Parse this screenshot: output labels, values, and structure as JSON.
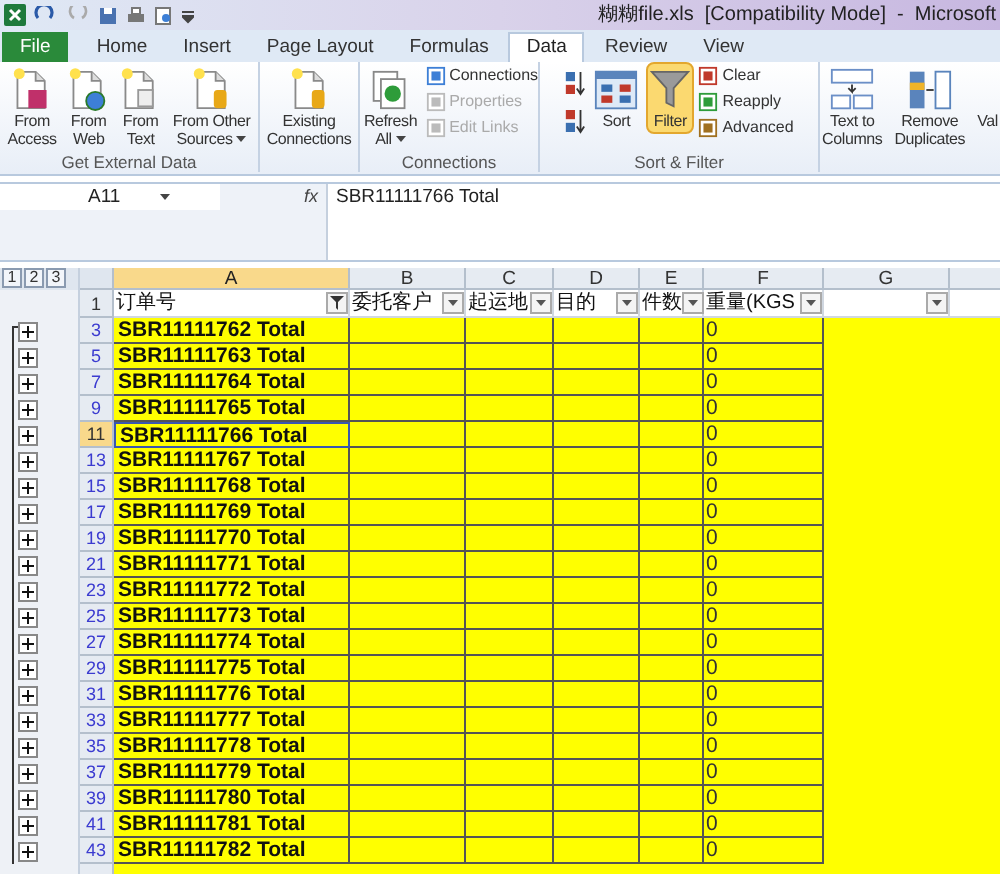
{
  "window": {
    "title": "糊糊file.xls  [Compatibility Mode]  -  Microsoft"
  },
  "tabs": [
    {
      "label": "File",
      "kind": "file",
      "selected": false
    },
    {
      "label": "Home",
      "kind": "tab",
      "selected": false
    },
    {
      "label": "Insert",
      "kind": "tab",
      "selected": false
    },
    {
      "label": "Page Layout",
      "kind": "tab",
      "selected": false
    },
    {
      "label": "Formulas",
      "kind": "tab",
      "selected": false
    },
    {
      "label": "Data",
      "kind": "tab",
      "selected": true
    },
    {
      "label": "Review",
      "kind": "tab",
      "selected": false
    },
    {
      "label": "View",
      "kind": "tab",
      "selected": false
    }
  ],
  "ribbon": {
    "groups": [
      {
        "label": "Get External Data",
        "items": [
          {
            "kind": "large",
            "label": "From\nAccess"
          },
          {
            "kind": "large",
            "label": "From\nWeb"
          },
          {
            "kind": "large",
            "label": "From\nText"
          },
          {
            "kind": "large",
            "label": "From Other\nSources",
            "caret": true
          }
        ]
      },
      {
        "items": [
          {
            "kind": "large",
            "label": "Existing\nConnections"
          }
        ]
      },
      {
        "label": "Connections",
        "items": [
          {
            "kind": "large",
            "label": "Refresh\nAll",
            "caret": true
          },
          {
            "kind": "small",
            "label": "Connections",
            "disabled": false
          },
          {
            "kind": "small",
            "label": "Properties",
            "disabled": true
          },
          {
            "kind": "small",
            "label": "Edit Links",
            "disabled": true
          }
        ]
      },
      {
        "label": "Sort & Filter",
        "items": [
          {
            "kind": "sortpair"
          },
          {
            "kind": "large",
            "label": "Sort"
          },
          {
            "kind": "large",
            "label": "Filter",
            "selected": true
          },
          {
            "kind": "small",
            "label": "Clear",
            "disabled": false
          },
          {
            "kind": "small",
            "label": "Reapply",
            "disabled": false
          },
          {
            "kind": "small",
            "label": "Advanced",
            "disabled": false
          }
        ]
      },
      {
        "items": [
          {
            "kind": "large",
            "label": "Text to\nColumns"
          },
          {
            "kind": "large",
            "label": "Remove\nDuplicates"
          },
          {
            "kind": "large",
            "label": "Val"
          }
        ]
      }
    ]
  },
  "formula_bar": {
    "name_box": "A11",
    "fx": "fx",
    "value": "SBR11111766 Total"
  },
  "outline_levels": [
    "1",
    "2",
    "3"
  ],
  "columns": [
    {
      "letter": "A",
      "selected": true
    },
    {
      "letter": "B",
      "selected": false
    },
    {
      "letter": "C",
      "selected": false
    },
    {
      "letter": "D",
      "selected": false
    },
    {
      "letter": "E",
      "selected": false
    },
    {
      "letter": "F",
      "selected": false
    },
    {
      "letter": "G",
      "selected": false
    }
  ],
  "header_row": {
    "number": "1",
    "cells": [
      {
        "label": "订单号",
        "filtered": true
      },
      {
        "label": "委托客户",
        "filtered": false
      },
      {
        "label": "起运地",
        "filtered": false
      },
      {
        "label": "目的",
        "filtered": false
      },
      {
        "label": "件数",
        "filtered": false
      },
      {
        "label": "重量(KGS",
        "filtered": false
      },
      {
        "filtered": false
      }
    ]
  },
  "rows": [
    {
      "number": "3",
      "order": "SBR11111762 Total",
      "weight": "0",
      "selected": false
    },
    {
      "number": "5",
      "order": "SBR11111763 Total",
      "weight": "0",
      "selected": false
    },
    {
      "number": "7",
      "order": "SBR11111764 Total",
      "weight": "0",
      "selected": false
    },
    {
      "number": "9",
      "order": "SBR11111765 Total",
      "weight": "0",
      "selected": false
    },
    {
      "number": "11",
      "order": "SBR11111766 Total",
      "weight": "0",
      "selected": true
    },
    {
      "number": "13",
      "order": "SBR11111767 Total",
      "weight": "0",
      "selected": false
    },
    {
      "number": "15",
      "order": "SBR11111768 Total",
      "weight": "0",
      "selected": false
    },
    {
      "number": "17",
      "order": "SBR11111769 Total",
      "weight": "0",
      "selected": false
    },
    {
      "number": "19",
      "order": "SBR11111770 Total",
      "weight": "0",
      "selected": false
    },
    {
      "number": "21",
      "order": "SBR11111771 Total",
      "weight": "0",
      "selected": false
    },
    {
      "number": "23",
      "order": "SBR11111772 Total",
      "weight": "0",
      "selected": false
    },
    {
      "number": "25",
      "order": "SBR11111773 Total",
      "weight": "0",
      "selected": false
    },
    {
      "number": "27",
      "order": "SBR11111774 Total",
      "weight": "0",
      "selected": false
    },
    {
      "number": "29",
      "order": "SBR11111775 Total",
      "weight": "0",
      "selected": false
    },
    {
      "number": "31",
      "order": "SBR11111776 Total",
      "weight": "0",
      "selected": false
    },
    {
      "number": "33",
      "order": "SBR11111777 Total",
      "weight": "0",
      "selected": false
    },
    {
      "number": "35",
      "order": "SBR11111778 Total",
      "weight": "0",
      "selected": false
    },
    {
      "number": "37",
      "order": "SBR11111779 Total",
      "weight": "0",
      "selected": false
    },
    {
      "number": "39",
      "order": "SBR11111780 Total",
      "weight": "0",
      "selected": false
    },
    {
      "number": "41",
      "order": "SBR11111781 Total",
      "weight": "0",
      "selected": false
    },
    {
      "number": "43",
      "order": "SBR11111782 Total",
      "weight": "0",
      "selected": false
    }
  ]
}
